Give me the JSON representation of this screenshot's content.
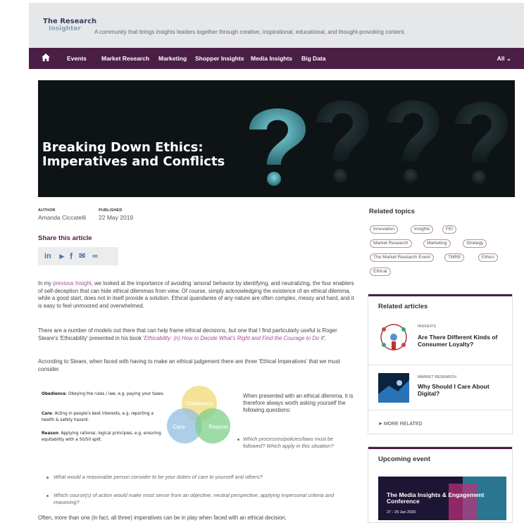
{
  "header": {
    "logo_line1": "The Research",
    "logo_line2": "Insighter",
    "tagline": "A community that brings insights leaders together through creative, inspirational, educational, and thought-provoking content."
  },
  "nav": {
    "items": [
      "Events",
      "Market Research",
      "Marketing",
      "Shopper Insights",
      "Media Insights",
      "Big Data"
    ],
    "all_label": "All"
  },
  "hero": {
    "title": "Breaking Down Ethics: Imperatives and Conflicts"
  },
  "meta": {
    "author_label": "AUTHOR",
    "author": "Amanda Ciccatelli",
    "published_label": "PUBLISHED",
    "published": "22 May 2019"
  },
  "share": {
    "title": "Share this article"
  },
  "article": {
    "p1_a": "In my ",
    "p1_link": "previous Insight",
    "p1_b": ", we looked at the importance of avoiding 'amoral' behavior by identifying, and neutralizing, the four enablers of self-deception that can hide ethical dilemmas from view. Of course, simply acknowledging the existence of an ethical dilemma, while a good start, does not in itself provide a solution. Ethical quandaries of any nature are often complex, messy and hard, and it is easy to feel unmoored and overwhelmed.",
    "p2_a": "There are a number of models out there that can help frame ethical decisions, but one that I find particularly useful is Roger Steare's 'Ethicability' presented in his book '",
    "p2_link": "Ethicability: (n) How to Decide What's Right and Find the Courage to Do It",
    "p2_b": "'.",
    "p3": "According to Steare, when faced with having to make an ethical judgement there are three 'Ethical Imperatives' that we must consider.",
    "imperatives": [
      {
        "term": "Obedience",
        "text": ": Obeying the rules / law, e.g. paying your taxes."
      },
      {
        "term": "Care",
        "text": ": Acting in people's best interests, e.g. reporting a health & safety hazard."
      },
      {
        "term": "Reason",
        "text": ": Applying rational, logical principles, e.g. ensuring equitability with a 50/50 split."
      }
    ],
    "venn": {
      "top": "Obedience",
      "left": "Care",
      "right": "Reason"
    },
    "venn_text": "When presented with an ethical dilemma, it is therefore always worth asking yourself the following questions:",
    "bullet1": "Which processes/policies/laws must be followed? Which apply in this situation?",
    "bullet2": "What would a reasonable person consider to be your duties of care to yourself and others?",
    "bullet3": "Which course(s) of action would make most sense from an objective, neutral perspective, applying impersonal criteria and reasoning?",
    "p4": "Often, more than one (in fact, all three) imperatives can be in play when faced with an ethical decision,"
  },
  "sidebar": {
    "related_topics_title": "Related topics",
    "topics": [
      "Innovation",
      "Insights",
      "FEI",
      "Market Research",
      "Marketing",
      "Strategy",
      "The Market Research Event",
      "TMRE",
      "Ethics",
      "Ethical"
    ],
    "related_articles_title": "Related articles",
    "articles": [
      {
        "category": "INSIGHTS",
        "title": "Are There Different Kinds of Consumer Loyalty?"
      },
      {
        "category": "MARKET RESEARCH",
        "title": "Why Should I Care About Digital?"
      }
    ],
    "more_related": "MORE RELATED",
    "upcoming_title": "Upcoming event",
    "event_title": "The Media Insights & Engagement Conference",
    "event_dates": "27 - 29 Jan 2020"
  },
  "colors": {
    "brand": "#4a1e45",
    "link": "#a34c9a",
    "share": "#4c74a8"
  }
}
